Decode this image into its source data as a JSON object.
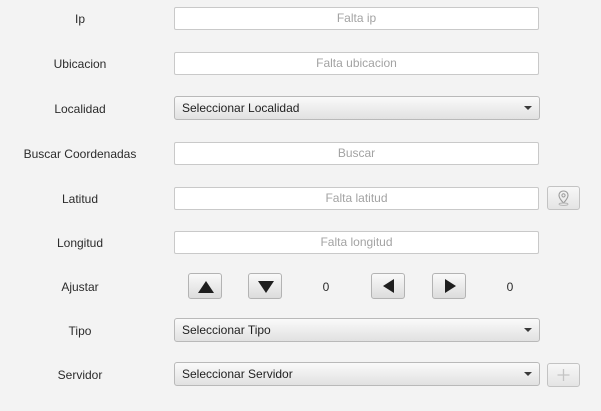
{
  "form": {
    "ip": {
      "label": "Ip",
      "placeholder": "Falta ip"
    },
    "ubicacion": {
      "label": "Ubicacion",
      "placeholder": "Falta ubicacion"
    },
    "localidad": {
      "label": "Localidad",
      "selected": "Seleccionar Localidad"
    },
    "buscar": {
      "label": "Buscar Coordenadas",
      "placeholder": "Buscar"
    },
    "latitud": {
      "label": "Latitud",
      "placeholder": "Falta latitud"
    },
    "longitud": {
      "label": "Longitud",
      "placeholder": "Falta longitud"
    },
    "ajustar": {
      "label": "Ajustar",
      "vertical_value": "0",
      "horizontal_value": "0"
    },
    "tipo": {
      "label": "Tipo",
      "selected": "Seleccionar Tipo"
    },
    "servidor": {
      "label": "Servidor",
      "selected": "Seleccionar Servidor"
    }
  },
  "icons": {
    "map_pin": "map-pin-icon",
    "add": "plus-icon",
    "up": "arrow-up-icon",
    "down": "arrow-down-icon",
    "left": "arrow-left-icon",
    "right": "arrow-right-icon",
    "dropdown": "chevron-down-icon"
  }
}
